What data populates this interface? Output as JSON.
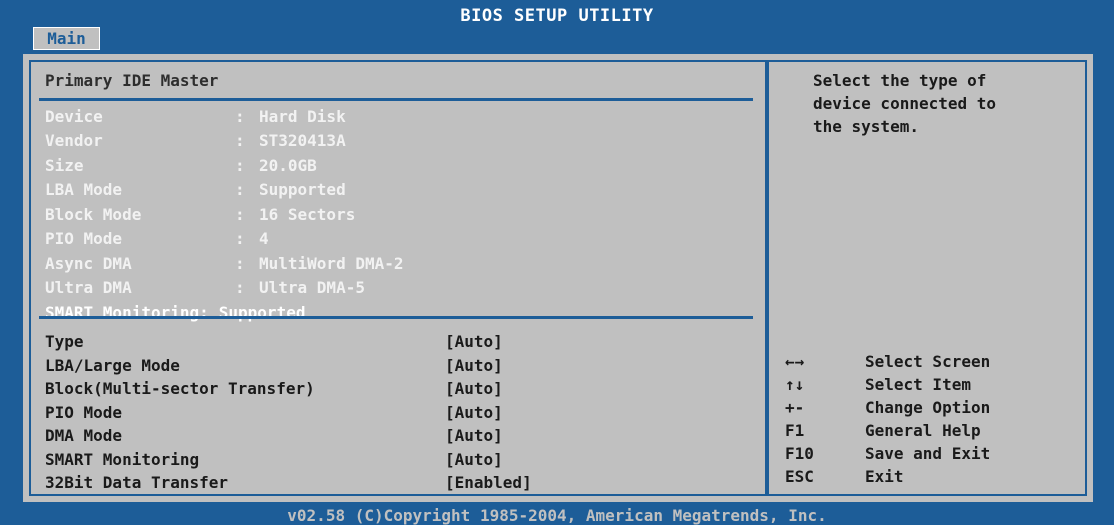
{
  "header": {
    "title": "BIOS SETUP UTILITY",
    "active_tab": "Main"
  },
  "panel": {
    "title": "Primary IDE Master"
  },
  "info": [
    {
      "label": "Device",
      "value": "Hard Disk"
    },
    {
      "label": "Vendor",
      "value": "ST320413A"
    },
    {
      "label": "Size",
      "value": "20.0GB"
    },
    {
      "label": "LBA Mode",
      "value": "Supported"
    },
    {
      "label": "Block Mode",
      "value": "16 Sectors"
    },
    {
      "label": "PIO Mode",
      "value": "4"
    },
    {
      "label": "Async DMA",
      "value": "MultiWord DMA-2"
    },
    {
      "label": "Ultra DMA",
      "value": "Ultra DMA-5"
    },
    {
      "label": "SMART Monitoring:",
      "value": "Supported"
    }
  ],
  "options": [
    {
      "label": "Type",
      "value": "[Auto]"
    },
    {
      "label": "LBA/Large Mode",
      "value": "[Auto]"
    },
    {
      "label": "Block(Multi-sector Transfer)",
      "value": "[Auto]"
    },
    {
      "label": "PIO Mode",
      "value": "[Auto]"
    },
    {
      "label": "DMA Mode",
      "value": "[Auto]"
    },
    {
      "label": "SMART Monitoring",
      "value": "[Auto]"
    },
    {
      "label": "32Bit Data Transfer",
      "value": "[Enabled]"
    }
  ],
  "help_text": [
    "Select the type of",
    "device connected to",
    "the system."
  ],
  "keys": [
    {
      "key": "←→",
      "desc": "Select Screen"
    },
    {
      "key": "↑↓",
      "desc": "Select Item"
    },
    {
      "key": "+-",
      "desc": "Change Option"
    },
    {
      "key": "F1",
      "desc": "General Help"
    },
    {
      "key": "F10",
      "desc": "Save and Exit"
    },
    {
      "key": "ESC",
      "desc": "Exit"
    }
  ],
  "footer": "v02.58 (C)Copyright 1985-2004, American Megatrends, Inc."
}
